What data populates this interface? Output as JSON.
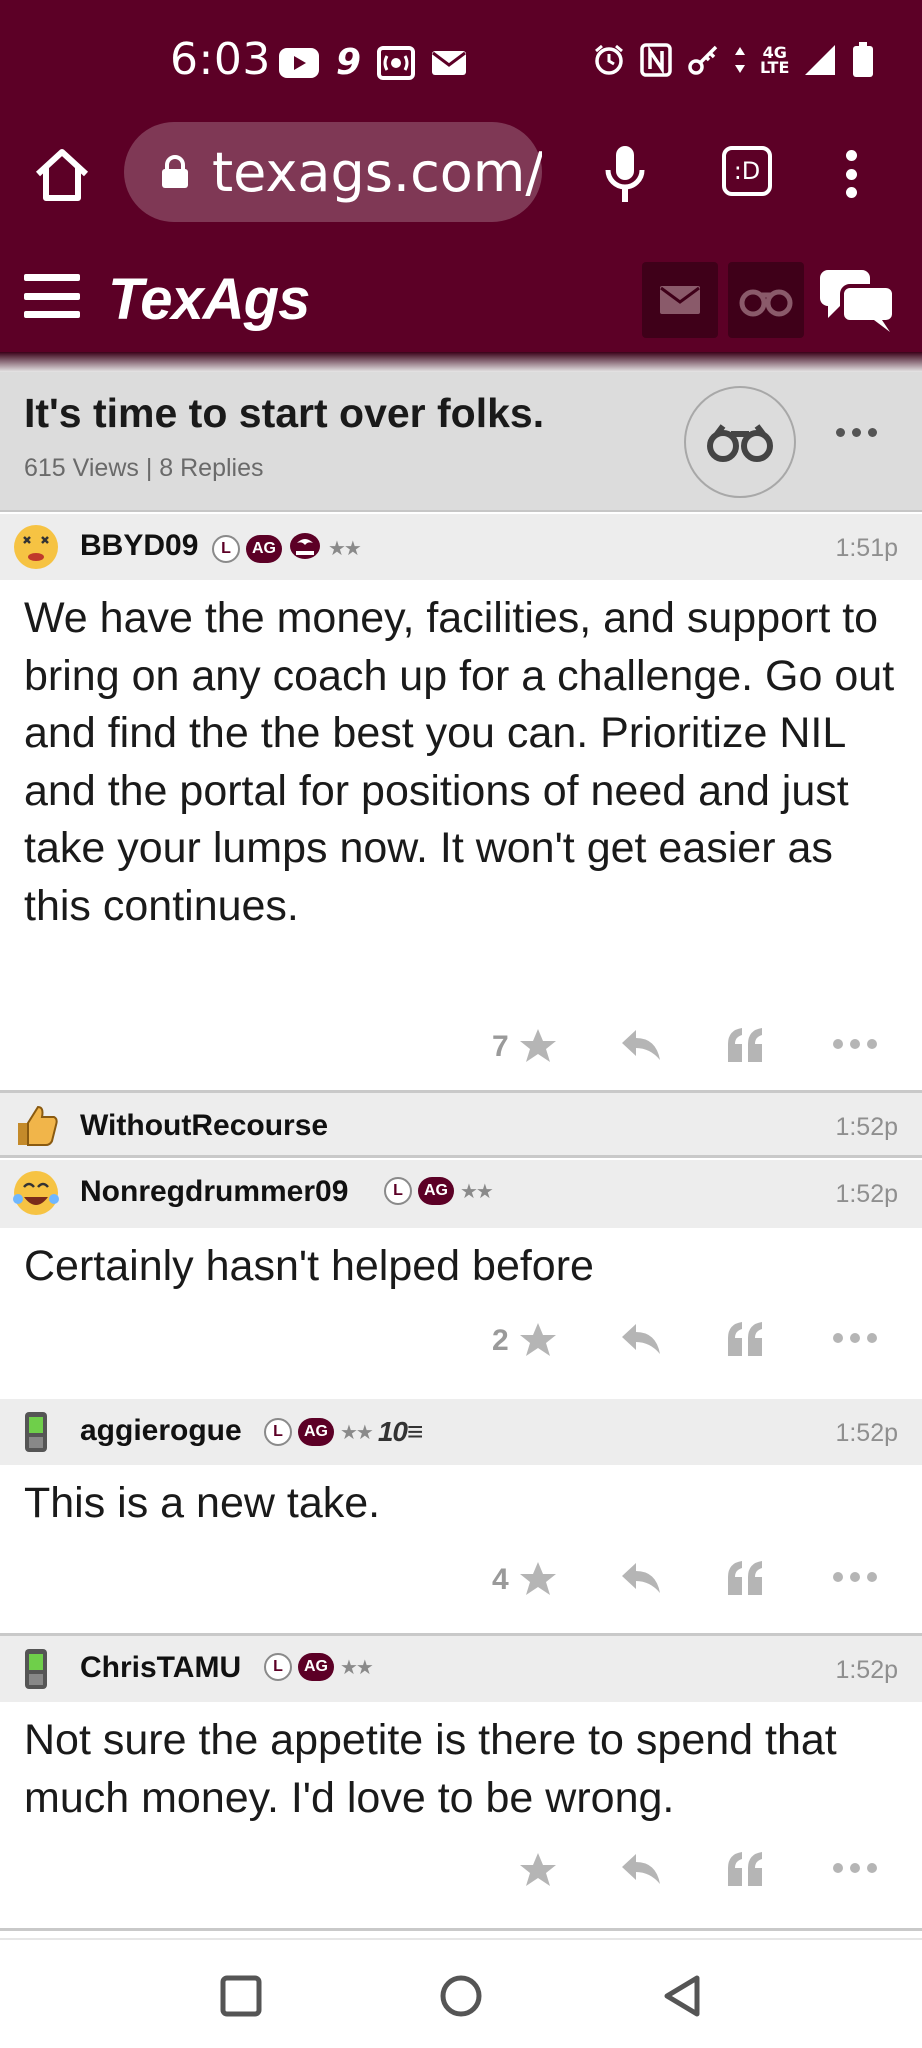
{
  "status_bar": {
    "time": "6:03",
    "network": "4G\nLTE",
    "icons_left": [
      "youtube-icon",
      "app-9-icon",
      "broadcast-icon",
      "mail-icon"
    ],
    "icons_right": [
      "alarm-icon",
      "nfc-icon",
      "key-icon",
      "data-arrows-icon",
      "signal-icon",
      "battery-icon"
    ]
  },
  "browser": {
    "url": "texags.com/",
    "tabs_label": ":D"
  },
  "site": {
    "logo": "TexAgs"
  },
  "thread": {
    "title": "It's time to start over folks.",
    "meta": "615 Views | 8 Replies"
  },
  "posts": [
    {
      "username": "BBYD09",
      "time": "1:51p",
      "badges": {
        "l": "L",
        "ag": "AG",
        "stars": "★★"
      },
      "body": "We have the money, facilities, and support to bring on any coach up for a challenge. Go out and find the the best you can. Prioritize NIL and the portal for positions of need and just take your lumps now. It won't get easier as this continues.",
      "stars": "7"
    },
    {
      "username": "WithoutRecourse",
      "time": "1:52p"
    },
    {
      "username": "Nonregdrummer09",
      "time": "1:52p",
      "badges": {
        "l": "L",
        "ag": "AG",
        "stars": "★★"
      },
      "body": "Certainly hasn't helped before",
      "stars": "2"
    },
    {
      "username": "aggierogue",
      "time": "1:52p",
      "badges": {
        "l": "L",
        "ag": "AG",
        "stars": "★★",
        "extra": "10≡"
      },
      "body": "This is a new take.",
      "stars": "4"
    },
    {
      "username": "ChrisTAMU",
      "time": "1:52p",
      "badges": {
        "l": "L",
        "ag": "AG",
        "stars": "★★"
      },
      "body": "Not sure the appetite is there to spend that much money. I'd love to be wrong.",
      "stars": ""
    }
  ],
  "colors": {
    "maroon": "#5c0026",
    "header_dark": "#3f0019",
    "thread_header_bg": "#dcdcdc",
    "post_header_bg": "#ededed",
    "action_gray": "#b5b5b5"
  }
}
